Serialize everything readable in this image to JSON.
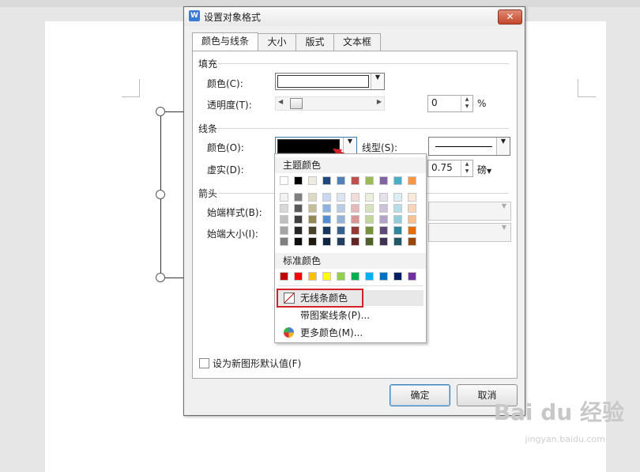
{
  "dialog": {
    "title": "设置对象格式",
    "app_icon": "W",
    "close": "✕",
    "tabs": [
      "颜色与线条",
      "大小",
      "版式",
      "文本框"
    ]
  },
  "fill": {
    "group": "填充",
    "color_label": "颜色(C):",
    "color": "#ffffff",
    "transparency_label": "透明度(T):",
    "transparency_value": "0",
    "transparency_unit": "%"
  },
  "line": {
    "group": "线条",
    "color_label": "颜色(O):",
    "color": "#000000",
    "style_label": "线型(S):",
    "dash_label": "虚实(D):",
    "weight_value": "0.75",
    "weight_unit": "磅"
  },
  "arrows": {
    "group": "箭头",
    "begin_style_label": "始端样式(B):",
    "begin_size_label": "始端大小(I):"
  },
  "default_checkbox_label": "设为新图形默认值(F)",
  "buttons": {
    "ok": "确定",
    "cancel": "取消"
  },
  "color_popup": {
    "theme_label": "主题颜色",
    "standard_label": "标准颜色",
    "theme_base": [
      "#ffffff",
      "#000000",
      "#eeece1",
      "#1f497d",
      "#4f81bd",
      "#c0504d",
      "#9bbb59",
      "#8064a2",
      "#4bacc6",
      "#f79646"
    ],
    "theme_shades": [
      [
        "#f2f2f2",
        "#7f7f7f",
        "#ddd9c3",
        "#c6d9f0",
        "#dbe5f1",
        "#f2dcdb",
        "#ebf1dd",
        "#e5e0ec",
        "#dbeef3",
        "#fdeada"
      ],
      [
        "#d8d8d8",
        "#595959",
        "#c4bd97",
        "#8db3e2",
        "#b8cce4",
        "#e5b9b7",
        "#d7e3bc",
        "#ccc1d9",
        "#b7dde8",
        "#fbd5b5"
      ],
      [
        "#bfbfbf",
        "#3f3f3f",
        "#938953",
        "#548dd4",
        "#95b3d7",
        "#d99694",
        "#c3d69b",
        "#b2a2c7",
        "#92cddc",
        "#fac08f"
      ],
      [
        "#a5a5a5",
        "#262626",
        "#494429",
        "#17365d",
        "#366092",
        "#953734",
        "#76923c",
        "#5f497a",
        "#31859b",
        "#e36c09"
      ],
      [
        "#7f7f7f",
        "#0c0c0c",
        "#1d1b10",
        "#0f243e",
        "#244061",
        "#632423",
        "#4f6128",
        "#3f3151",
        "#205867",
        "#974806"
      ]
    ],
    "standard": [
      "#c00000",
      "#ff0000",
      "#ffc000",
      "#ffff00",
      "#92d050",
      "#00b050",
      "#00b0f0",
      "#0070c0",
      "#002060",
      "#7030a0"
    ],
    "no_line": "无线条颜色",
    "pattern_line": "带图案线条(P)...",
    "more_colors": "更多颜色(M)..."
  },
  "watermark": {
    "brand": "Bai du 经验",
    "url": "jingyan.baidu.com"
  }
}
